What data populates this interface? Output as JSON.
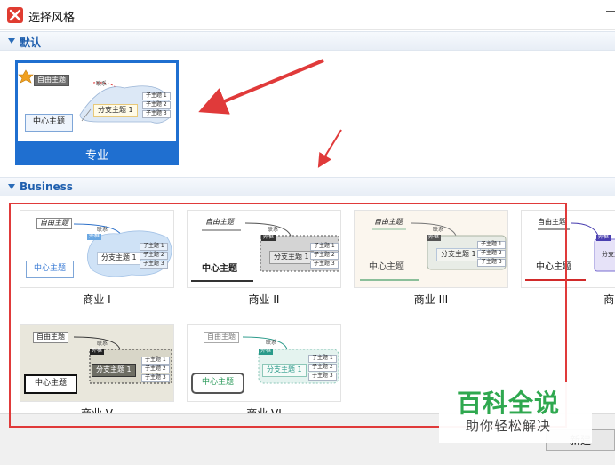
{
  "window": {
    "title": "选择风格"
  },
  "sections": [
    {
      "label": "默认"
    },
    {
      "label": "Business"
    }
  ],
  "default_templates": [
    {
      "name": "专业",
      "selected": true
    }
  ],
  "business_templates": [
    {
      "name": "商业 I"
    },
    {
      "name": "商业 II"
    },
    {
      "name": "商业 III"
    },
    {
      "name": "商业 IV"
    },
    {
      "name": "商业 V"
    },
    {
      "name": "商业 VI"
    }
  ],
  "thumbnail_text": {
    "free_topic": "自由主题",
    "relation": "联系",
    "outside": "外框",
    "center_topic": "中心主题",
    "branch_topic": "分支主题 1",
    "subtopics": [
      "子主题 1",
      "子主题 2",
      "子主题 3"
    ]
  },
  "footer": {
    "new_button": "新建"
  },
  "watermark": {
    "title": "百科全说",
    "subtitle": "助你轻松解决"
  },
  "colors": {
    "accent": "#1f6fd0",
    "annotation_red": "#e03a3a",
    "watermark_green": "#2fa84f"
  }
}
